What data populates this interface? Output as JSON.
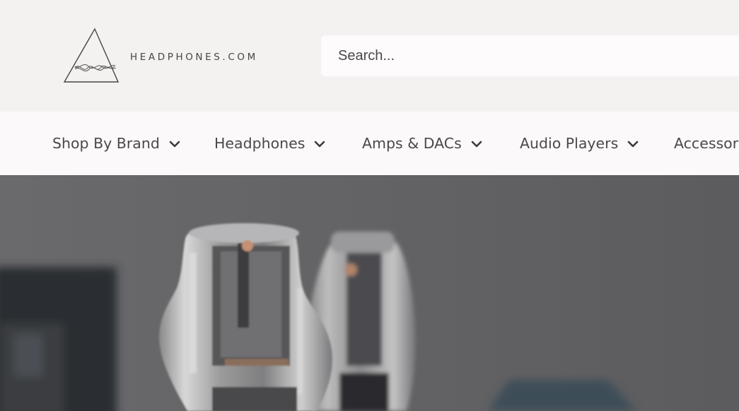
{
  "brand": {
    "name": "HEADPHONES.COM"
  },
  "search": {
    "placeholder": "Search..."
  },
  "nav": {
    "items": [
      {
        "label": "Shop By Brand"
      },
      {
        "label": "Headphones"
      },
      {
        "label": "Amps & DACs"
      },
      {
        "label": "Audio Players"
      },
      {
        "label": "Accessor"
      }
    ]
  },
  "icons": {
    "logo": "triangle-waveform-logo-icon",
    "nav_dropdown": "chevron-down-icon"
  },
  "colors": {
    "header_bg": "#f4f1f1",
    "nav_bg": "#fbf9f9",
    "text": "#4e4749",
    "hero_bg": "#5e5e60"
  },
  "hero": {
    "image": "blurred vacuum tubes photo"
  }
}
